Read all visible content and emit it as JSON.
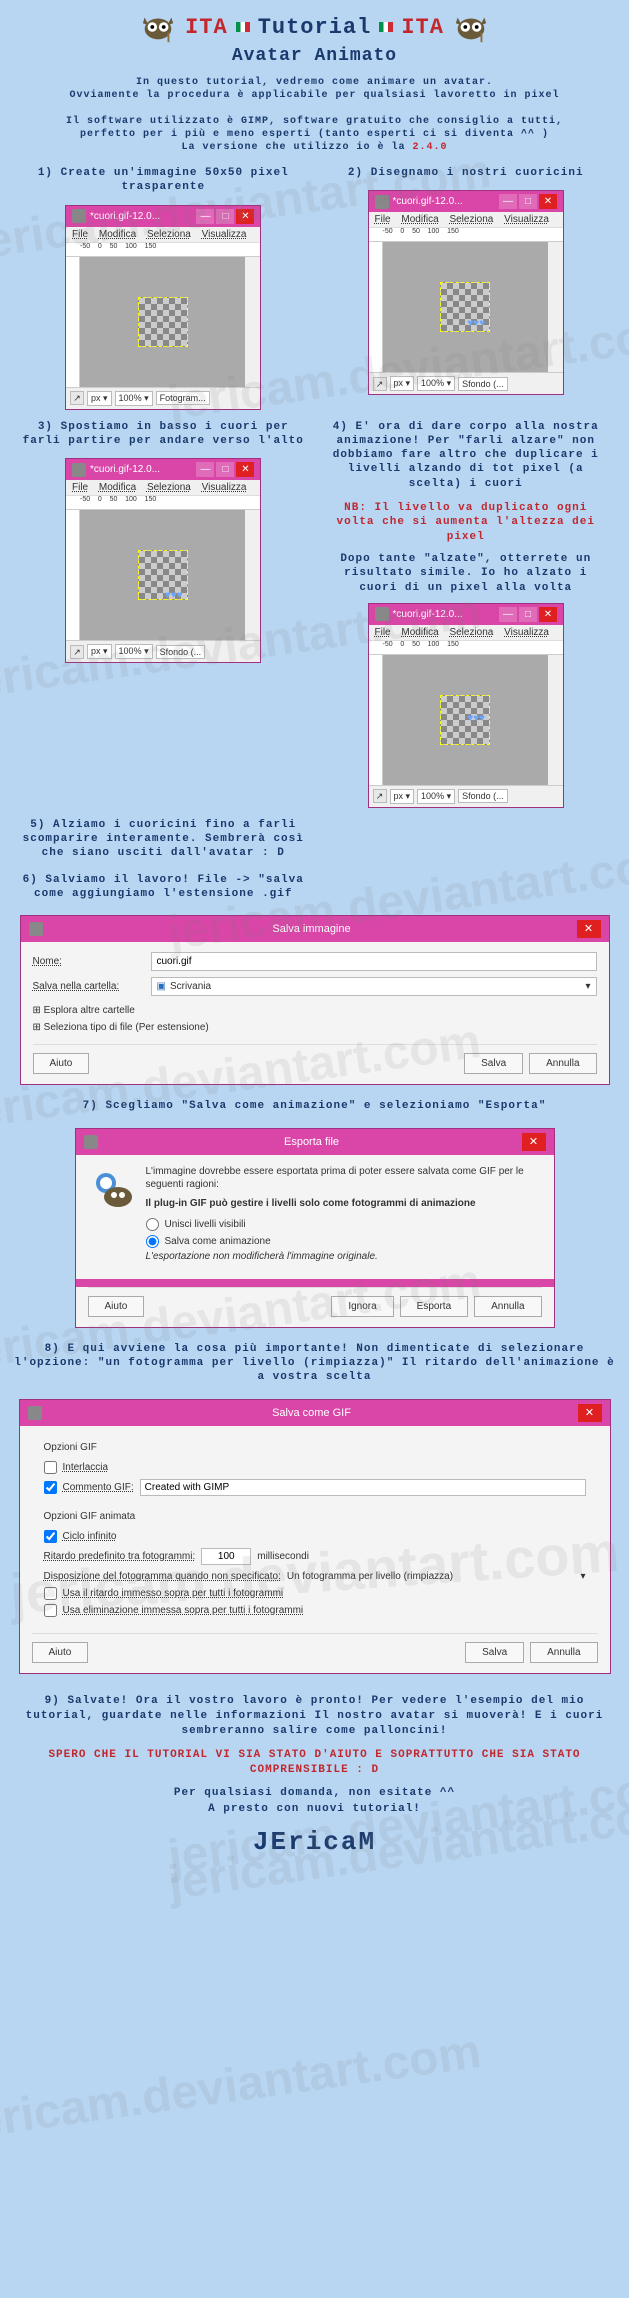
{
  "header": {
    "ita": "ITA",
    "tutorial": "Tutorial",
    "subtitle": "Avatar Animato"
  },
  "intro": {
    "line1": "In questo tutorial, vedremo come animare un avatar.",
    "line2": "Ovviamente la procedura è applicabile per qualsiasi lavoretto in pixel",
    "line3": "Il software utilizzato è GIMP, software gratuito che consiglio a tutti,",
    "line4": "perfetto per i più e meno esperti (tanto esperti ci si diventa ^^ )",
    "line5": "La versione che utilizzo io è la ",
    "version": "2.4.0"
  },
  "steps": {
    "s1": "1) Create un'immagine 50x50 pixel trasparente",
    "s2": "2) Disegnamo i nostri cuoricini",
    "s3": "3) Spostiamo in basso i cuori per farli partire per andare verso l'alto",
    "s4a": "4) E' ora di dare corpo alla nostra animazione! Per \"farli alzare\" non dobbiamo fare altro che duplicare i livelli alzando di tot pixel (a scelta) i cuori",
    "s4nb": "NB: Il livello va duplicato ogni volta che si aumenta l'altezza dei pixel",
    "s4b": "Dopo tante \"alzate\", otterrete un risultato simile. Io ho alzato i cuori di un pixel alla volta",
    "s5": "5) Alziamo i cuoricini fino a farli scomparire interamente. Sembrerà così che siano usciti dall'avatar : D",
    "s6": "6) Salviamo il lavoro! File -> \"salva come aggiungiamo l'estensione .gif",
    "s7": "7) Scegliamo \"Salva come animazione\" e selezioniamo \"Esporta\"",
    "s8": "8) E qui avviene la cosa più importante! Non dimenticate di selezionare l'opzione: \"un fotogramma per livello (rimpiazza)\" Il ritardo dell'animazione è a vostra scelta",
    "s9": "9) Salvate! Ora il vostro lavoro è pronto! Per vedere l'esempio del mio tutorial, guardate nelle informazioni Il nostro avatar si muoverà! E i cuori sembreranno salire come palloncini!"
  },
  "gimp": {
    "title": "*cuori.gif-12.0...",
    "menu": {
      "file": "File",
      "modifica": "Modifica",
      "seleziona": "Seleziona",
      "visualizza": "Visualizza"
    },
    "status": {
      "px": "px",
      "zoom": "100%",
      "bg1": "Fotogram...",
      "bg2": "Sfondo (..."
    }
  },
  "save_dialog": {
    "title": "Salva immagine",
    "name_label": "Nome:",
    "name_value": "cuori.gif",
    "folder_label": "Salva nella cartella:",
    "folder_value": "Scrivania",
    "expand1": "Esplora altre cartelle",
    "expand2": "Seleziona tipo di file (Per estensione)",
    "help": "Aiuto",
    "save": "Salva",
    "cancel": "Annulla"
  },
  "export_dialog": {
    "title": "Esporta file",
    "msg1": "L'immagine dovrebbe essere esportata prima di poter essere salvata come GIF per le seguenti ragioni:",
    "msg2": "Il plug-in GIF può gestire i livelli solo come fotogrammi di animazione",
    "opt1": "Unisci livelli visibili",
    "opt2": "Salva come animazione",
    "msg3": "L'esportazione non modificherà l'immagine originale.",
    "help": "Aiuto",
    "ignore": "Ignora",
    "export": "Esporta",
    "cancel": "Annulla"
  },
  "gif_dialog": {
    "title": "Salva come GIF",
    "sec1": "Opzioni GIF",
    "interlace": "Interlaccia",
    "comment_label": "Commento GIF:",
    "comment_value": "Created with GIMP",
    "sec2": "Opzioni GIF animata",
    "loop": "Ciclo infinito",
    "delay_label": "Ritardo predefinito tra fotogrammi:",
    "delay_value": "100",
    "delay_unit": "millisecondi",
    "disp_label": "Disposizione del fotogramma quando non specificato:",
    "disp_value": "Un fotogramma per livello (rimpiazza)",
    "use_delay": "Usa il ritardo immesso sopra per tutti i fotogrammi",
    "use_disp": "Usa eliminazione immessa sopra per tutti i fotogrammi",
    "help": "Aiuto",
    "save": "Salva",
    "cancel": "Annulla"
  },
  "footer": {
    "red": "SPERO CHE IL TUTORIAL VI SIA STATO D'AIUTO E SOPRATTUTTO CHE SIA STATO COMPRENSIBILE : D",
    "line1": "Per qualsiasi domanda, non esitate ^^",
    "line2": "A presto con nuovi tutorial!",
    "signature": "JEricaM"
  },
  "watermark": "jericam.deviantart.com"
}
